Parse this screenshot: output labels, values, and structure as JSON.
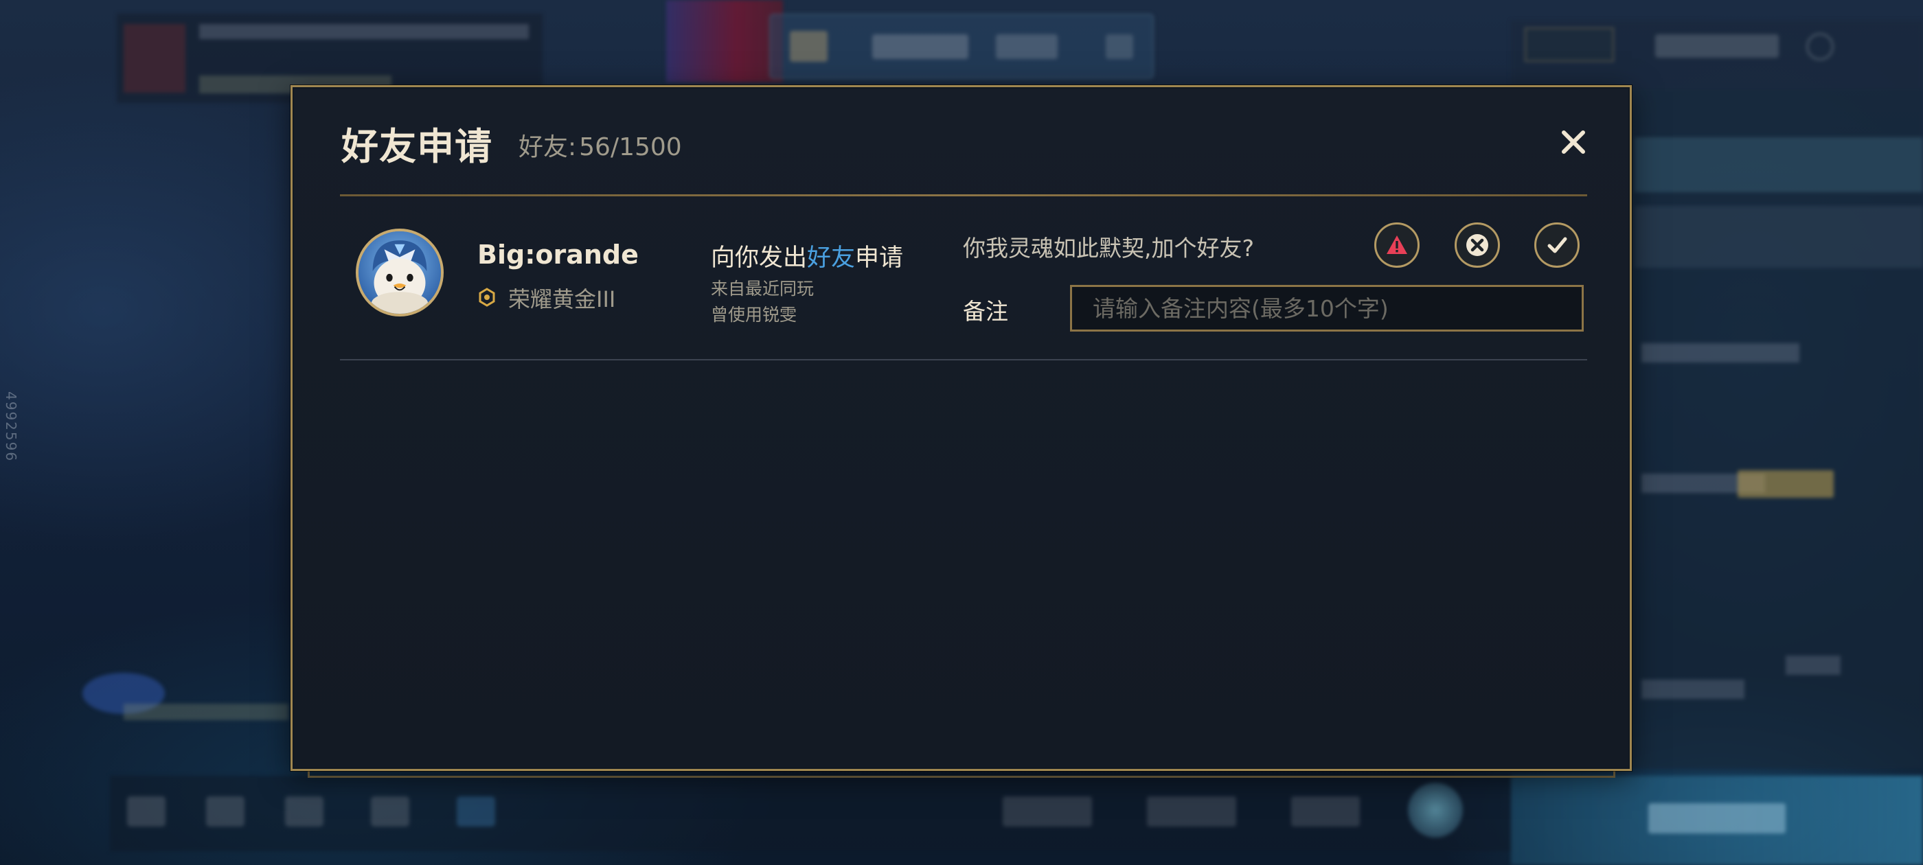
{
  "background": {
    "side_id": "4992596"
  },
  "modal": {
    "title": "好友申请",
    "friend_count_label": "好友:",
    "friend_count_value": "56/1500",
    "close_icon": "close-icon"
  },
  "request": {
    "player_name": "Big:orande",
    "rank": "荣耀黄金III",
    "message_prefix": "向你发出",
    "message_highlight": "好友",
    "message_suffix": "申请",
    "source": "来自最近同玩",
    "used": "曾使用锐雯",
    "greeting": "你我灵魂如此默契,加个好友?",
    "remark_label": "备注",
    "remark_placeholder": "请输入备注内容(最多10个字)",
    "remark_value": "",
    "actions": {
      "report_icon": "warning-icon",
      "decline_icon": "x-circle-icon",
      "accept_icon": "check-icon"
    }
  },
  "colors": {
    "gold": "#c8aa6e",
    "gold_border": "#a08750",
    "text_primary": "#f0e6d2",
    "text_secondary": "#a09b8c",
    "highlight_blue": "#4aa0e0",
    "report_red": "#e84057",
    "modal_bg": "#131a24"
  }
}
